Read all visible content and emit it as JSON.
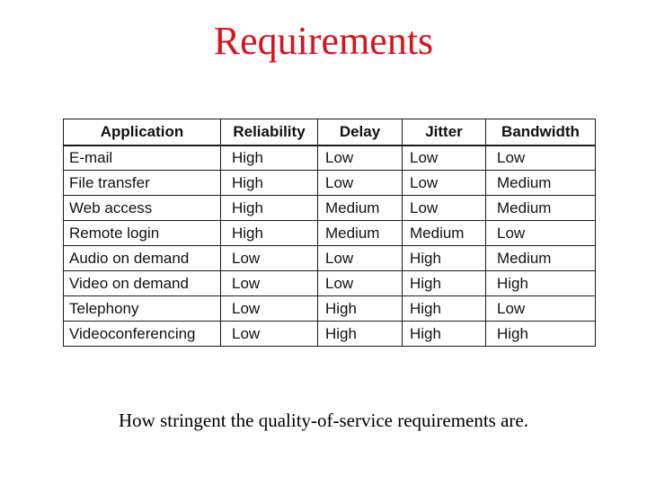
{
  "slide": {
    "title": "Requirements",
    "title_color": "#d9141c",
    "caption": "How stringent the quality-of-service requirements are."
  },
  "table": {
    "headers": [
      "Application",
      "Reliability",
      "Delay",
      "Jitter",
      "Bandwidth"
    ],
    "rows": [
      [
        "E-mail",
        "High",
        "Low",
        "Low",
        "Low"
      ],
      [
        "File transfer",
        "High",
        "Low",
        "Low",
        "Medium"
      ],
      [
        "Web access",
        "High",
        "Medium",
        "Low",
        "Medium"
      ],
      [
        "Remote login",
        "High",
        "Medium",
        "Medium",
        "Low"
      ],
      [
        "Audio on demand",
        "Low",
        "Low",
        "High",
        "Medium"
      ],
      [
        "Video on demand",
        "Low",
        "Low",
        "High",
        "High"
      ],
      [
        "Telephony",
        "Low",
        "High",
        "High",
        "Low"
      ],
      [
        "Videoconferencing",
        "Low",
        "High",
        "High",
        "High"
      ]
    ]
  }
}
